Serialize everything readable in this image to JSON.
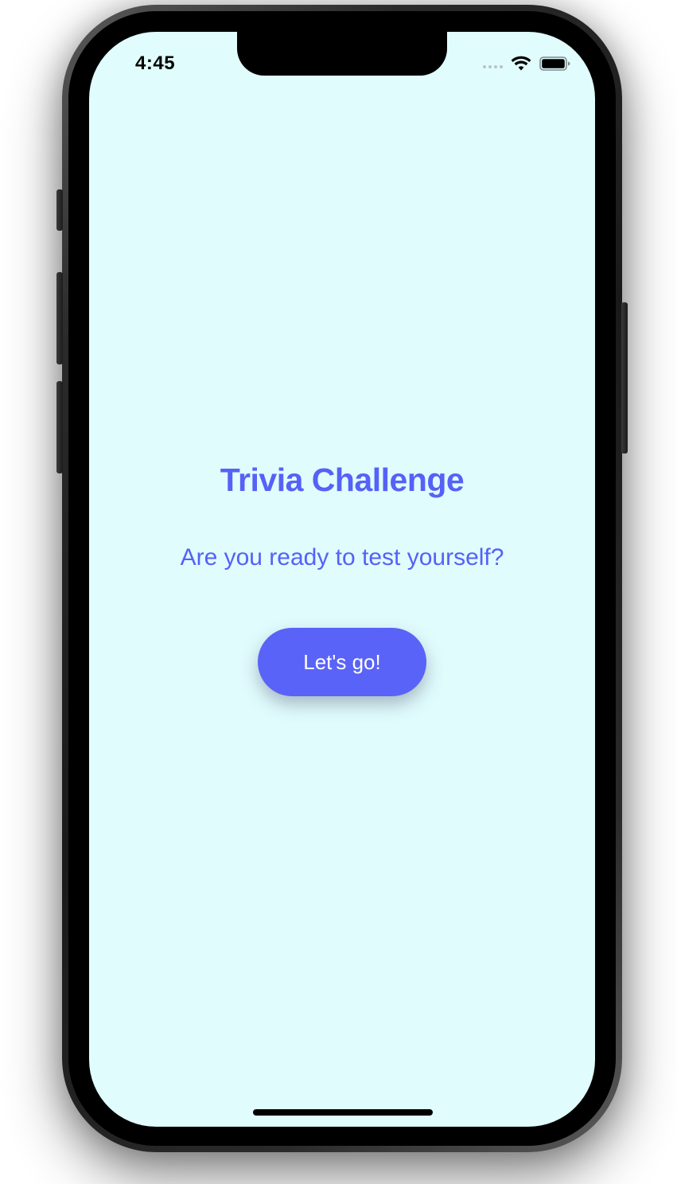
{
  "status_bar": {
    "time": "4:45",
    "icons": [
      "cellular-dots-icon",
      "wifi-icon",
      "battery-icon"
    ]
  },
  "screen": {
    "background_color": "#e0fcfd",
    "title": "Trivia Challenge",
    "subtitle": "Are you ready to test yourself?",
    "start_button_label": "Let's go!",
    "accent_color": "#5561f7"
  }
}
